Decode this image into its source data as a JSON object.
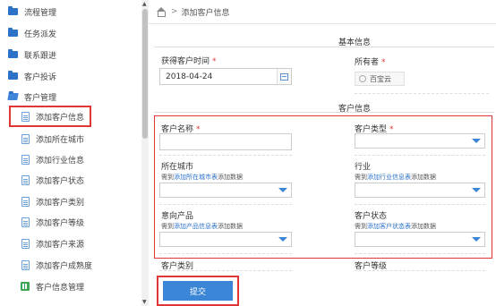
{
  "sidebar": {
    "items": [
      {
        "label": "流程管理",
        "icon": "folder-icon"
      },
      {
        "label": "任务派发",
        "icon": "folder-icon"
      },
      {
        "label": "联系跟进",
        "icon": "folder-icon"
      },
      {
        "label": "客户投诉",
        "icon": "folder-icon"
      },
      {
        "label": "客户管理",
        "icon": "folder-open-icon"
      },
      {
        "label": "添加客户信息",
        "icon": "document-icon"
      },
      {
        "label": "添加所在城市",
        "icon": "document-icon"
      },
      {
        "label": "添加行业信息",
        "icon": "document-icon"
      },
      {
        "label": "添加客户状态",
        "icon": "document-icon"
      },
      {
        "label": "添加客户类别",
        "icon": "document-icon"
      },
      {
        "label": "添加客户等级",
        "icon": "document-icon"
      },
      {
        "label": "添加客户来源",
        "icon": "document-icon"
      },
      {
        "label": "添加客户成熟度",
        "icon": "document-icon"
      },
      {
        "label": "客户信息管理",
        "icon": "grid-icon"
      }
    ]
  },
  "breadcrumb": {
    "sep": ">",
    "current": "添加客户信息"
  },
  "sections": {
    "basic": "基本信息",
    "customer": "客户信息"
  },
  "basic": {
    "time_label": "获得客户时间",
    "time_value": "2018-04-24",
    "owner_label": "所有者",
    "owner_value": "百宝云"
  },
  "fields": {
    "name_label": "客户名称",
    "type_label": "客户类型",
    "city_label": "所在城市",
    "industry_label": "行业",
    "product_label": "意向产品",
    "status_label": "客户状态",
    "category_label": "客户类别",
    "level_label": "客户等级"
  },
  "hints": {
    "prefix": "需到",
    "suffix": "添加数据",
    "city_link": "添加所在城市表",
    "industry_link": "添加行业信息表",
    "product_link": "添加产品信息表",
    "status_link": "添加客户状态表"
  },
  "required_mark": "*",
  "submit_label": "提交",
  "colors": {
    "accent": "#3b86d6",
    "highlight": "#e03636"
  }
}
